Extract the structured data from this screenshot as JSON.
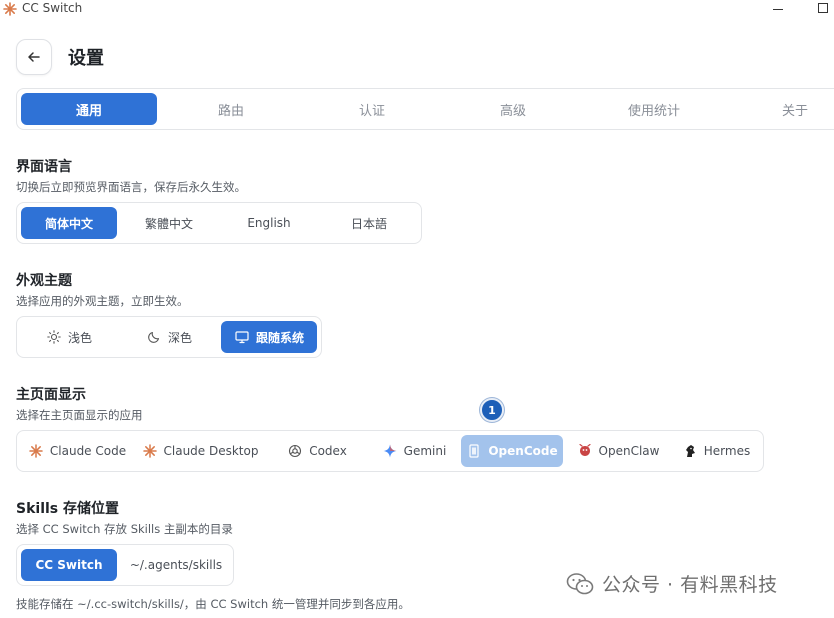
{
  "window": {
    "title": "CC Switch"
  },
  "header": {
    "title": "设置"
  },
  "tabs": [
    {
      "label": "通用",
      "active": true
    },
    {
      "label": "路由",
      "active": false
    },
    {
      "label": "认证",
      "active": false
    },
    {
      "label": "高级",
      "active": false
    },
    {
      "label": "使用统计",
      "active": false
    },
    {
      "label": "关于",
      "active": false
    }
  ],
  "language": {
    "title": "界面语言",
    "description": "切换后立即预览界面语言，保存后永久生效。",
    "options": [
      "简体中文",
      "繁體中文",
      "English",
      "日本語"
    ],
    "selected": "简体中文"
  },
  "theme": {
    "title": "外观主题",
    "description": "选择应用的外观主题，立即生效。",
    "options": [
      {
        "label": "浅色",
        "icon": "sun-icon"
      },
      {
        "label": "深色",
        "icon": "moon-icon"
      },
      {
        "label": "跟随系统",
        "icon": "monitor-icon"
      }
    ],
    "selected": "跟随系统"
  },
  "home_display": {
    "title": "主页面显示",
    "description": "选择在主页面显示的应用",
    "apps": [
      {
        "label": "Claude Code",
        "icon": "claude-icon"
      },
      {
        "label": "Claude Desktop",
        "icon": "claude-icon"
      },
      {
        "label": "Codex",
        "icon": "openai-icon"
      },
      {
        "label": "Gemini",
        "icon": "gemini-icon"
      },
      {
        "label": "OpenCode",
        "icon": "opencode-icon"
      },
      {
        "label": "OpenClaw",
        "icon": "openclaw-icon"
      },
      {
        "label": "Hermes",
        "icon": "hermes-icon"
      }
    ],
    "hovered": "OpenCode",
    "annotation_badge": "1"
  },
  "skills_storage": {
    "title": "Skills 存储位置",
    "description": "选择 CC Switch 存放 Skills 主副本的目录",
    "options": [
      "CC Switch",
      "~/.agents/skills"
    ],
    "selected": "CC Switch",
    "note": "技能存储在 ~/.cc-switch/skills/，由 CC Switch 统一管理并同步到各应用。"
  },
  "watermark": {
    "text": "公众号 · 有料黑科技"
  },
  "colors": {
    "accent": "#2f72d6",
    "hover": "#a3c3ec",
    "badge": "#1d5fb8"
  }
}
